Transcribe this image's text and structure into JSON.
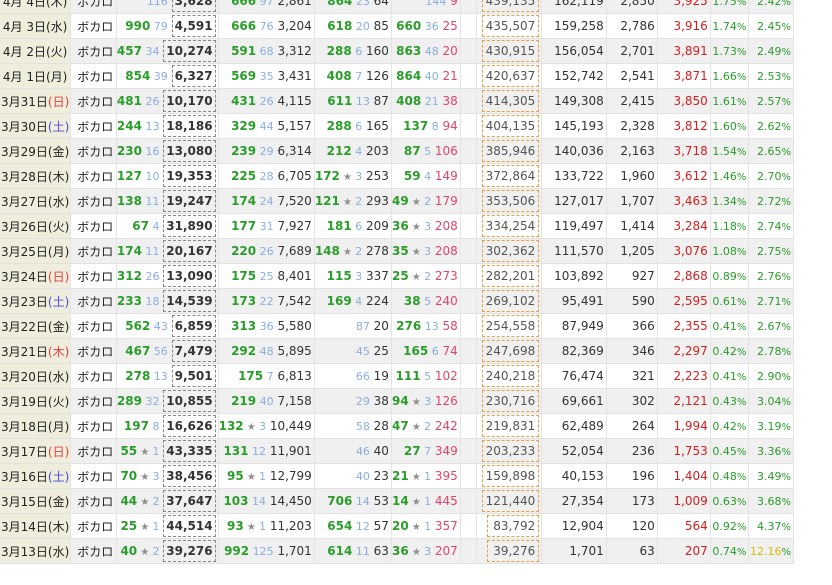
{
  "genre_label": "ボカロ",
  "rows": [
    {
      "date": "4月 4日",
      "wd": "(木)",
      "wdt": "",
      "nd_rank": "",
      "nd_sub": "116",
      "view": "3,628",
      "a_rank": "666",
      "a_sub": "97",
      "a_val": "2,861",
      "b_rank": "864",
      "b_sub": "23",
      "b_val": "64",
      "c_rank": "",
      "c_sub": "144",
      "c_val": "9",
      "total": "439,135",
      "col7": "162,119",
      "col8": "2,850",
      "col9": "3,925",
      "p1": "1.75",
      "p2": "2.42"
    },
    {
      "date": "4月 3日",
      "wd": "(水)",
      "wdt": "",
      "nd_rank": "990",
      "nd_sub": "79",
      "view": "4,591",
      "a_rank": "666",
      "a_sub": "76",
      "a_val": "3,204",
      "b_rank": "618",
      "b_sub": "20",
      "b_val": "85",
      "c_rank": "660",
      "c_sub": "36",
      "c_val": "25",
      "total": "435,507",
      "col7": "159,258",
      "col8": "2,786",
      "col9": "3,916",
      "p1": "1.74",
      "p2": "2.45"
    },
    {
      "date": "4月 2日",
      "wd": "(火)",
      "wdt": "",
      "nd_rank": "457",
      "nd_sub": "34",
      "view": "10,274",
      "a_rank": "591",
      "a_sub": "68",
      "a_val": "3,312",
      "b_rank": "288",
      "b_sub": "6",
      "b_val": "160",
      "c_rank": "863",
      "c_sub": "48",
      "c_val": "20",
      "total": "430,915",
      "col7": "156,054",
      "col8": "2,701",
      "col9": "3,891",
      "p1": "1.73",
      "p2": "2.49"
    },
    {
      "date": "4月 1日",
      "wd": "(月)",
      "wdt": "",
      "nd_rank": "854",
      "nd_sub": "39",
      "view": "6,327",
      "a_rank": "569",
      "a_sub": "35",
      "a_val": "3,431",
      "b_rank": "408",
      "b_sub": "7",
      "b_val": "126",
      "c_rank": "864",
      "c_sub": "40",
      "c_val": "21",
      "total": "420,637",
      "col7": "152,742",
      "col8": "2,541",
      "col9": "3,871",
      "p1": "1.66",
      "p2": "2.53"
    },
    {
      "date": "3月31日",
      "wd": "(日)",
      "wdt": "sun",
      "nd_rank": "481",
      "nd_sub": "26",
      "view": "10,170",
      "a_rank": "431",
      "a_sub": "26",
      "a_val": "4,115",
      "b_rank": "611",
      "b_sub": "13",
      "b_val": "87",
      "c_rank": "408",
      "c_sub": "21",
      "c_val": "38",
      "total": "414,305",
      "col7": "149,308",
      "col8": "2,415",
      "col9": "3,850",
      "p1": "1.61",
      "p2": "2.57"
    },
    {
      "date": "3月30日",
      "wd": "(土)",
      "wdt": "sat",
      "nd_rank": "244",
      "nd_sub": "13",
      "view": "18,186",
      "a_rank": "329",
      "a_sub": "44",
      "a_val": "5,157",
      "b_rank": "288",
      "b_sub": "6",
      "b_val": "165",
      "c_rank": "137",
      "c_sub": "8",
      "c_val": "94",
      "total": "404,135",
      "col7": "145,193",
      "col8": "2,328",
      "col9": "3,812",
      "p1": "1.60",
      "p2": "2.62"
    },
    {
      "date": "3月29日",
      "wd": "(金)",
      "wdt": "",
      "nd_rank": "230",
      "nd_sub": "16",
      "view": "13,080",
      "a_rank": "239",
      "a_sub": "29",
      "a_val": "6,314",
      "b_rank": "212",
      "b_sub": "4",
      "b_val": "203",
      "c_rank": "87",
      "c_sub": "5",
      "c_val": "106",
      "total": "385,946",
      "col7": "140,036",
      "col8": "2,163",
      "col9": "3,718",
      "p1": "1.54",
      "p2": "2.65"
    },
    {
      "date": "3月28日",
      "wd": "(木)",
      "wdt": "",
      "nd_rank": "127",
      "nd_sub": "10",
      "view": "19,353",
      "a_rank": "225",
      "a_sub": "28",
      "a_val": "6,705",
      "b_rank": "172",
      "b_sub": "3",
      "b_val": "253",
      "c_rank": "59",
      "c_sub": "4",
      "c_val": "149",
      "total": "372,864",
      "col7": "133,722",
      "col8": "1,960",
      "col9": "3,612",
      "p1": "1.46",
      "p2": "2.70",
      "b_star": true
    },
    {
      "date": "3月27日",
      "wd": "(水)",
      "wdt": "",
      "nd_rank": "138",
      "nd_sub": "11",
      "view": "19,247",
      "a_rank": "174",
      "a_sub": "24",
      "a_val": "7,520",
      "b_rank": "121",
      "b_sub": "2",
      "b_val": "293",
      "c_rank": "49",
      "c_sub": "2",
      "c_val": "179",
      "total": "353,506",
      "col7": "127,017",
      "col8": "1,707",
      "col9": "3,463",
      "p1": "1.34",
      "p2": "2.72",
      "b_star": true,
      "c_star": true
    },
    {
      "date": "3月26日",
      "wd": "(火)",
      "wdt": "",
      "nd_rank": "67",
      "nd_sub": "4",
      "view": "31,890",
      "a_rank": "177",
      "a_sub": "31",
      "a_val": "7,927",
      "b_rank": "181",
      "b_sub": "6",
      "b_val": "209",
      "c_rank": "36",
      "c_sub": "3",
      "c_val": "208",
      "total": "334,254",
      "col7": "119,497",
      "col8": "1,414",
      "col9": "3,284",
      "p1": "1.18",
      "p2": "2.74",
      "c_star": true
    },
    {
      "date": "3月25日",
      "wd": "(月)",
      "wdt": "",
      "nd_rank": "174",
      "nd_sub": "11",
      "view": "20,167",
      "a_rank": "220",
      "a_sub": "26",
      "a_val": "7,689",
      "b_rank": "148",
      "b_sub": "2",
      "b_val": "278",
      "c_rank": "35",
      "c_sub": "3",
      "c_val": "208",
      "total": "302,362",
      "col7": "111,570",
      "col8": "1,205",
      "col9": "3,076",
      "p1": "1.08",
      "p2": "2.75",
      "b_star": true,
      "c_star": true
    },
    {
      "date": "3月24日",
      "wd": "(日)",
      "wdt": "sun",
      "nd_rank": "312",
      "nd_sub": "26",
      "view": "13,090",
      "a_rank": "175",
      "a_sub": "25",
      "a_val": "8,401",
      "b_rank": "115",
      "b_sub": "3",
      "b_val": "337",
      "c_rank": "25",
      "c_sub": "2",
      "c_val": "273",
      "total": "282,201",
      "col7": "103,892",
      "col8": "927",
      "col9": "2,868",
      "p1": "0.89",
      "p2": "2.76",
      "c_star": true
    },
    {
      "date": "3月23日",
      "wd": "(土)",
      "wdt": "sat",
      "nd_rank": "233",
      "nd_sub": "18",
      "view": "14,539",
      "a_rank": "173",
      "a_sub": "22",
      "a_val": "7,542",
      "b_rank": "169",
      "b_sub": "4",
      "b_val": "224",
      "c_rank": "38",
      "c_sub": "5",
      "c_val": "240",
      "total": "269,102",
      "col7": "95,491",
      "col8": "590",
      "col9": "2,595",
      "p1": "0.61",
      "p2": "2.71"
    },
    {
      "date": "3月22日",
      "wd": "(金)",
      "wdt": "",
      "nd_rank": "562",
      "nd_sub": "43",
      "view": "6,859",
      "a_rank": "313",
      "a_sub": "36",
      "a_val": "5,580",
      "b_rank": "",
      "b_sub": "87",
      "b_val": "20",
      "c_rank": "276",
      "c_sub": "13",
      "c_val": "58",
      "total": "254,558",
      "col7": "87,949",
      "col8": "366",
      "col9": "2,355",
      "p1": "0.41",
      "p2": "2.67"
    },
    {
      "date": "3月21日",
      "wd": "(木)",
      "wdt": "sun",
      "nd_rank": "467",
      "nd_sub": "56",
      "view": "7,479",
      "a_rank": "292",
      "a_sub": "48",
      "a_val": "5,895",
      "b_rank": "",
      "b_sub": "45",
      "b_val": "25",
      "c_rank": "165",
      "c_sub": "6",
      "c_val": "74",
      "total": "247,698",
      "col7": "82,369",
      "col8": "346",
      "col9": "2,297",
      "p1": "0.42",
      "p2": "2.78"
    },
    {
      "date": "3月20日",
      "wd": "(水)",
      "wdt": "",
      "nd_rank": "278",
      "nd_sub": "13",
      "view": "9,501",
      "a_rank": "175",
      "a_sub": "7",
      "a_val": "6,813",
      "b_rank": "",
      "b_sub": "66",
      "b_val": "19",
      "c_rank": "111",
      "c_sub": "5",
      "c_val": "102",
      "total": "240,218",
      "col7": "76,474",
      "col8": "321",
      "col9": "2,223",
      "p1": "0.41",
      "p2": "2.90"
    },
    {
      "date": "3月19日",
      "wd": "(火)",
      "wdt": "",
      "nd_rank": "289",
      "nd_sub": "32",
      "view": "10,855",
      "a_rank": "219",
      "a_sub": "40",
      "a_val": "7,158",
      "b_rank": "",
      "b_sub": "29",
      "b_val": "38",
      "c_rank": "94",
      "c_sub": "3",
      "c_val": "126",
      "total": "230,716",
      "col7": "69,661",
      "col8": "302",
      "col9": "2,121",
      "p1": "0.43",
      "p2": "3.04",
      "c_star": true
    },
    {
      "date": "3月18日",
      "wd": "(月)",
      "wdt": "",
      "nd_rank": "197",
      "nd_sub": "8",
      "view": "16,626",
      "a_rank": "132",
      "a_sub": "3",
      "a_val": "10,449",
      "b_rank": "",
      "b_sub": "58",
      "b_val": "28",
      "c_rank": "47",
      "c_sub": "2",
      "c_val": "242",
      "total": "219,831",
      "col7": "62,489",
      "col8": "264",
      "col9": "1,994",
      "p1": "0.42",
      "p2": "3.19",
      "a_star": true,
      "c_star": true
    },
    {
      "date": "3月17日",
      "wd": "(日)",
      "wdt": "sun",
      "nd_rank": "55",
      "nd_sub": "1",
      "view": "43,335",
      "a_rank": "131",
      "a_sub": "12",
      "a_val": "11,901",
      "b_rank": "",
      "b_sub": "46",
      "b_val": "40",
      "c_rank": "27",
      "c_sub": "7",
      "c_val": "349",
      "total": "203,233",
      "col7": "52,054",
      "col8": "236",
      "col9": "1,753",
      "p1": "0.45",
      "p2": "3.36",
      "nd_star": true
    },
    {
      "date": "3月16日",
      "wd": "(土)",
      "wdt": "sat",
      "nd_rank": "70",
      "nd_sub": "3",
      "view": "38,456",
      "a_rank": "95",
      "a_sub": "1",
      "a_val": "12,799",
      "b_rank": "",
      "b_sub": "40",
      "b_val": "23",
      "c_rank": "21",
      "c_sub": "1",
      "c_val": "395",
      "total": "159,898",
      "col7": "40,153",
      "col8": "196",
      "col9": "1,404",
      "p1": "0.48",
      "p2": "3.49",
      "nd_star": true,
      "a_star": true,
      "c_star": true
    },
    {
      "date": "3月15日",
      "wd": "(金)",
      "wdt": "",
      "nd_rank": "44",
      "nd_sub": "2",
      "view": "37,647",
      "a_rank": "103",
      "a_sub": "14",
      "a_val": "14,450",
      "b_rank": "706",
      "b_sub": "14",
      "b_val": "53",
      "c_rank": "14",
      "c_sub": "1",
      "c_val": "445",
      "total": "121,440",
      "col7": "27,354",
      "col8": "173",
      "col9": "1,009",
      "p1": "0.63",
      "p2": "3.68",
      "nd_star": true,
      "c_star": true
    },
    {
      "date": "3月14日",
      "wd": "(木)",
      "wdt": "",
      "nd_rank": "25",
      "nd_sub": "1",
      "view": "44,514",
      "a_rank": "93",
      "a_sub": "1",
      "a_val": "11,203",
      "b_rank": "654",
      "b_sub": "12",
      "b_val": "57",
      "c_rank": "20",
      "c_sub": "1",
      "c_val": "357",
      "total": "83,792",
      "col7": "12,904",
      "col8": "120",
      "col9": "564",
      "p1": "0.92",
      "p2": "4.37",
      "nd_star": true,
      "a_star": true,
      "c_star": true
    },
    {
      "date": "3月13日",
      "wd": "(水)",
      "wdt": "",
      "nd_rank": "40",
      "nd_sub": "2",
      "view": "39,276",
      "a_rank": "992",
      "a_sub": "125",
      "a_val": "1,701",
      "b_rank": "614",
      "b_sub": "11",
      "b_val": "63",
      "c_rank": "36",
      "c_sub": "3",
      "c_val": "207",
      "total": "39,276",
      "col7": "1,701",
      "col8": "63",
      "col9": "207",
      "p1": "0.74",
      "p2": "12.16",
      "nd_star": true,
      "c_star": true
    }
  ]
}
